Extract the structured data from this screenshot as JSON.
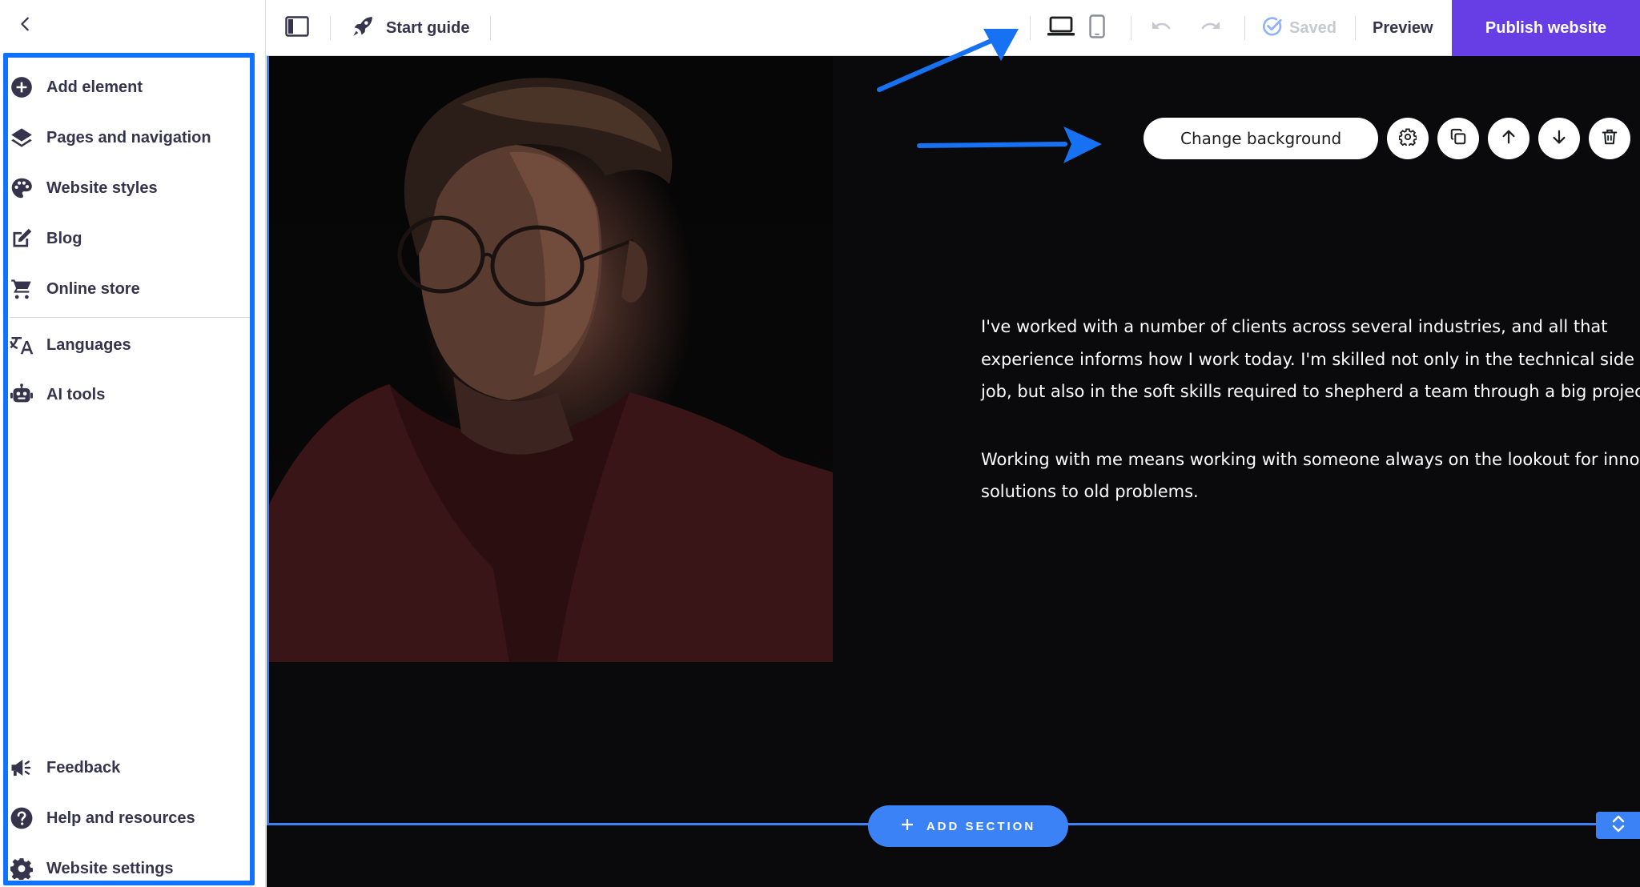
{
  "sidebar": {
    "back_icon": "chevron-left-icon",
    "items_top": [
      {
        "label": "Add element",
        "icon": "plus-circle-icon"
      },
      {
        "label": "Pages and navigation",
        "icon": "layers-icon"
      },
      {
        "label": "Website styles",
        "icon": "palette-icon"
      },
      {
        "label": "Blog",
        "icon": "edit-icon"
      },
      {
        "label": "Online store",
        "icon": "cart-icon"
      }
    ],
    "items_mid": [
      {
        "label": "Languages",
        "icon": "translate-icon"
      },
      {
        "label": "AI tools",
        "icon": "robot-icon"
      }
    ],
    "items_bottom": [
      {
        "label": "Feedback",
        "icon": "megaphone-icon"
      },
      {
        "label": "Help and resources",
        "icon": "help-circle-icon"
      },
      {
        "label": "Website settings",
        "icon": "gear-icon"
      }
    ]
  },
  "topbar": {
    "start_guide_label": "Start guide",
    "saved_label": "Saved",
    "preview_label": "Preview",
    "publish_label": "Publish website"
  },
  "section_toolbar": {
    "change_background_label": "Change background"
  },
  "content": {
    "paragraph1": [
      "I've worked with a number of clients across several industries, and all that",
      "experience informs how I work today. I'm skilled not only in the technical side of m",
      "job, but also in the soft skills required to shepherd a team through a big project."
    ],
    "paragraph2": [
      "Working with me means working with someone always on the lookout for innovati",
      "solutions to old problems."
    ]
  },
  "add_section_label": "ADD SECTION",
  "colors": {
    "accent_purple": "#673de6",
    "highlight_blue": "#0f73ff",
    "section_blue": "#3b82f6",
    "canvas_bg": "#0a0a0d",
    "text_dark": "#36344d"
  }
}
